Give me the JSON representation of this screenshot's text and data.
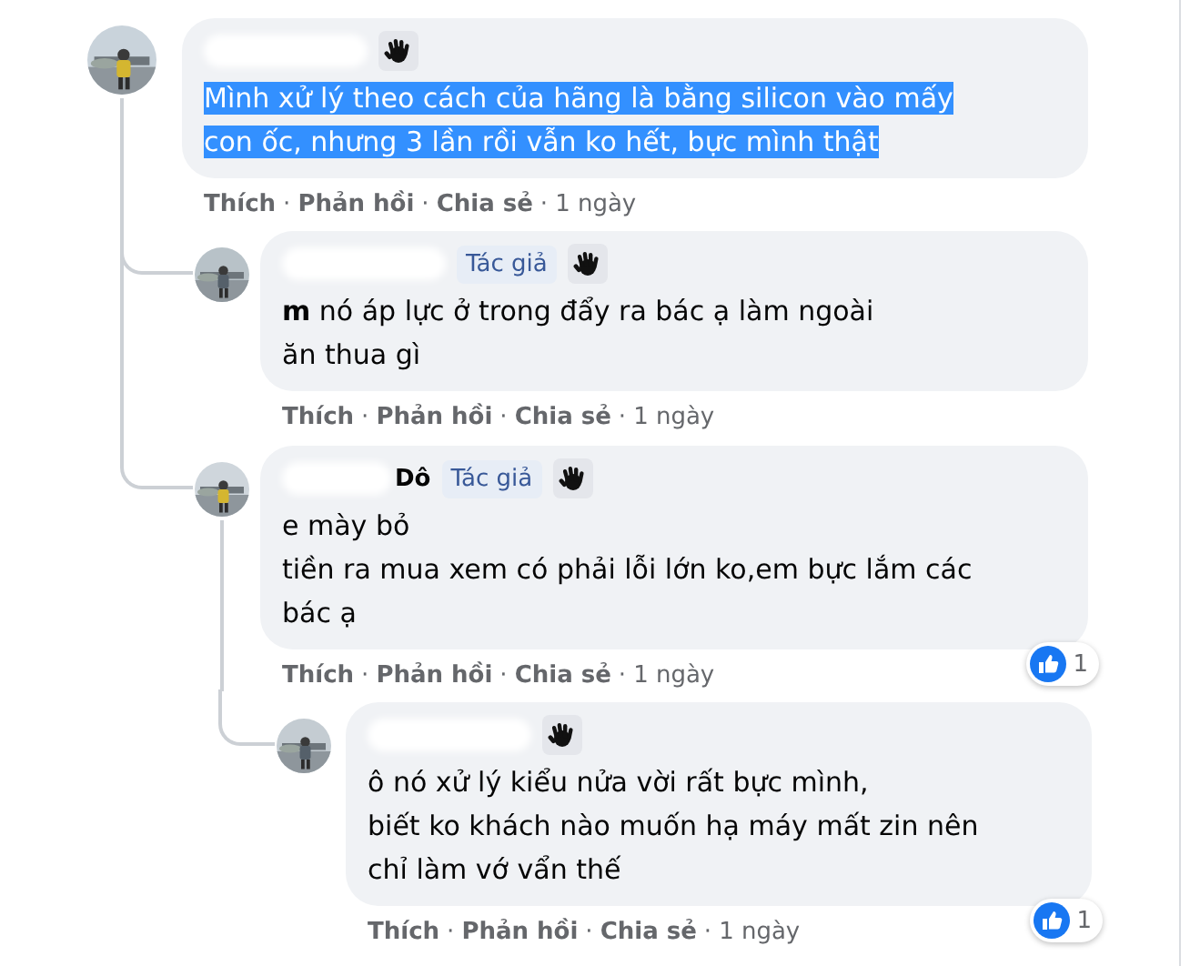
{
  "separator": "·",
  "comments": [
    {
      "name_redacted": true,
      "hand_badge": true,
      "text": "Mình xử lý theo cách của hãng là bằng silicon vào mấy\ncon ốc, nhưng 3 lần rồi vẫn ko hết, bực mình thật",
      "highlighted": true,
      "actions": [
        "Thích",
        "Phản hồi",
        "Chia sẻ"
      ],
      "time": "1 ngày",
      "replies": [
        {
          "name_redacted": true,
          "author_label": "Tác giả",
          "hand_badge": true,
          "text": "**m** nó áp lực ở trong đẩy ra bác ạ làm ngoài\năn thua gì",
          "highlighted": false,
          "actions": [
            "Thích",
            "Phản hồi",
            "Chia sẻ"
          ],
          "time": "1 ngày"
        },
        {
          "name_redacted": true,
          "name": "Dô",
          "author_label": "Tác giả",
          "hand_badge": true,
          "text": "e mày bỏ\ntiền ra mua xem có phải lỗi lớn ko,em bực lắm các\nbác ạ",
          "highlighted": false,
          "reaction_count": "1",
          "actions": [
            "Thích",
            "Phản hồi",
            "Chia sẻ"
          ],
          "time": "1 ngày",
          "replies": [
            {
              "name_redacted": true,
              "hand_badge": true,
              "text": "ô nó xử lý kiểu nửa vời rất bực mình,\nbiết ko khách nào muốn hạ máy mất zin nên\nchỉ làm vớ vẩn thế",
              "highlighted": false,
              "reaction_count": "1",
              "actions": [
                "Thích",
                "Phản hồi",
                "Chia sẻ"
              ],
              "time": "1 ngày"
            }
          ]
        }
      ]
    }
  ]
}
